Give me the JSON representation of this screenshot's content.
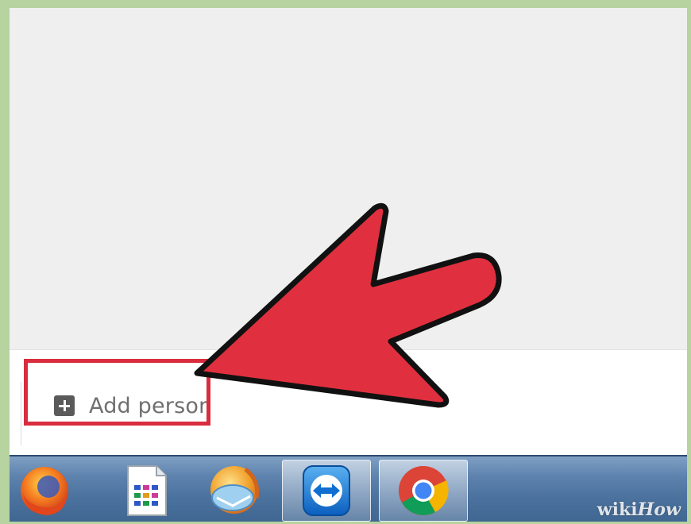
{
  "people_panel": {
    "add_person_label": "Add person"
  },
  "taskbar": {
    "apps": [
      {
        "icon": "firefox-icon"
      },
      {
        "icon": "file-explorer-icon"
      },
      {
        "icon": "thunderbird-icon"
      },
      {
        "icon": "teamviewer-icon"
      },
      {
        "icon": "chrome-icon"
      }
    ]
  },
  "watermark": {
    "wiki": "wiki",
    "how": "How"
  },
  "colors": {
    "highlight": "#d92d3f",
    "arrow": "#e0303f",
    "frame": "#b6d3a0"
  }
}
